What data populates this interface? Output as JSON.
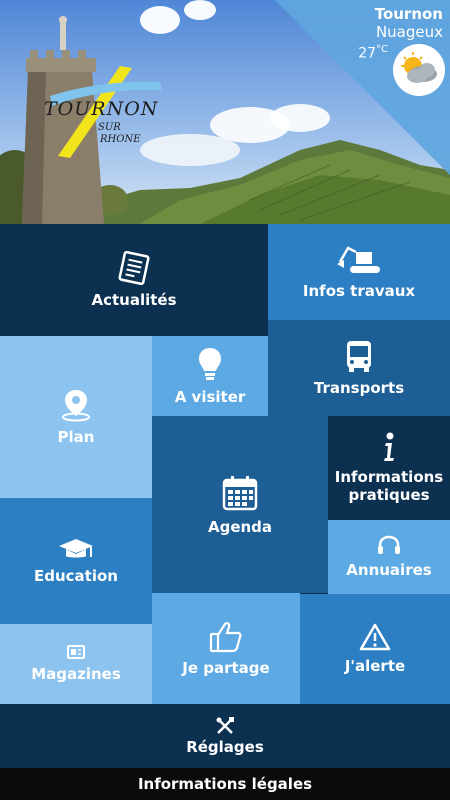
{
  "hero": {
    "logo_main": "TOURNON",
    "logo_sub_1": "SUR",
    "logo_sub_2": "RHONE"
  },
  "weather": {
    "city": "Tournon",
    "condition": "Nuageux",
    "temperature": "27",
    "unit": "°C",
    "icon": "partly-cloudy-icon"
  },
  "tiles": {
    "actualites": "Actualités",
    "infos_travaux": "Infos travaux",
    "plan": "Plan",
    "a_visiter": "A visiter",
    "transports": "Transports",
    "agenda": "Agenda",
    "informations_1": "Informations",
    "informations_2": "pratiques",
    "education": "Education",
    "annuaires": "Annuaires",
    "magazines": "Magazines",
    "je_partage": "Je partage",
    "jalerte": "J'alerte",
    "reglages": "Réglages"
  },
  "footer": {
    "label": "Informations légales"
  },
  "colors": {
    "dark": "#0b3050",
    "mid": "#1d5f95",
    "blue": "#2b7fc2",
    "light": "#5da9e3",
    "lighter": "#8cc3ef"
  }
}
